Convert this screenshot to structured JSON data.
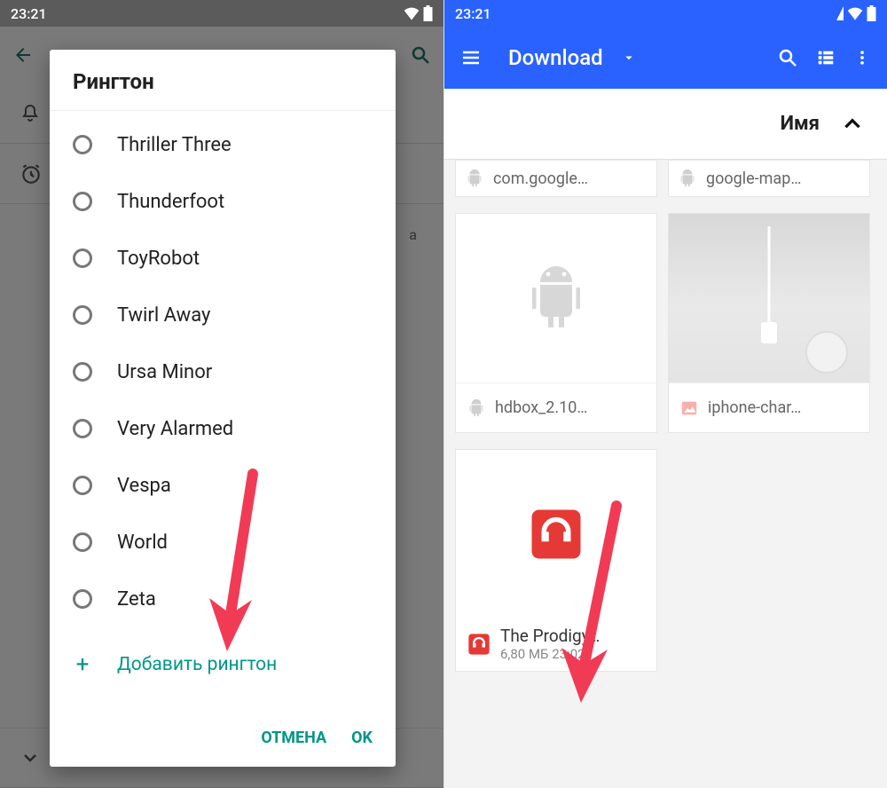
{
  "status": {
    "time": "23:21"
  },
  "left": {
    "dialog_title": "Рингтон",
    "ringtones": [
      "Thriller Three",
      "Thunderfoot",
      "ToyRobot",
      "Twirl Away",
      "Ursa Minor",
      "Very Alarmed",
      "Vespa",
      "World",
      "Zeta"
    ],
    "add_label": "Добавить рингтон",
    "cancel": "ОТМЕНА",
    "ok": "OK"
  },
  "right": {
    "appbar_title": "Download",
    "sort_label": "Имя",
    "files_top": [
      "com.google…",
      "google-map…"
    ],
    "file_apk": "hdbox_2.10…",
    "file_img": "iphone-char…",
    "music": {
      "title": "The Prodigy…",
      "meta": "6,80 МБ  23:02"
    }
  }
}
